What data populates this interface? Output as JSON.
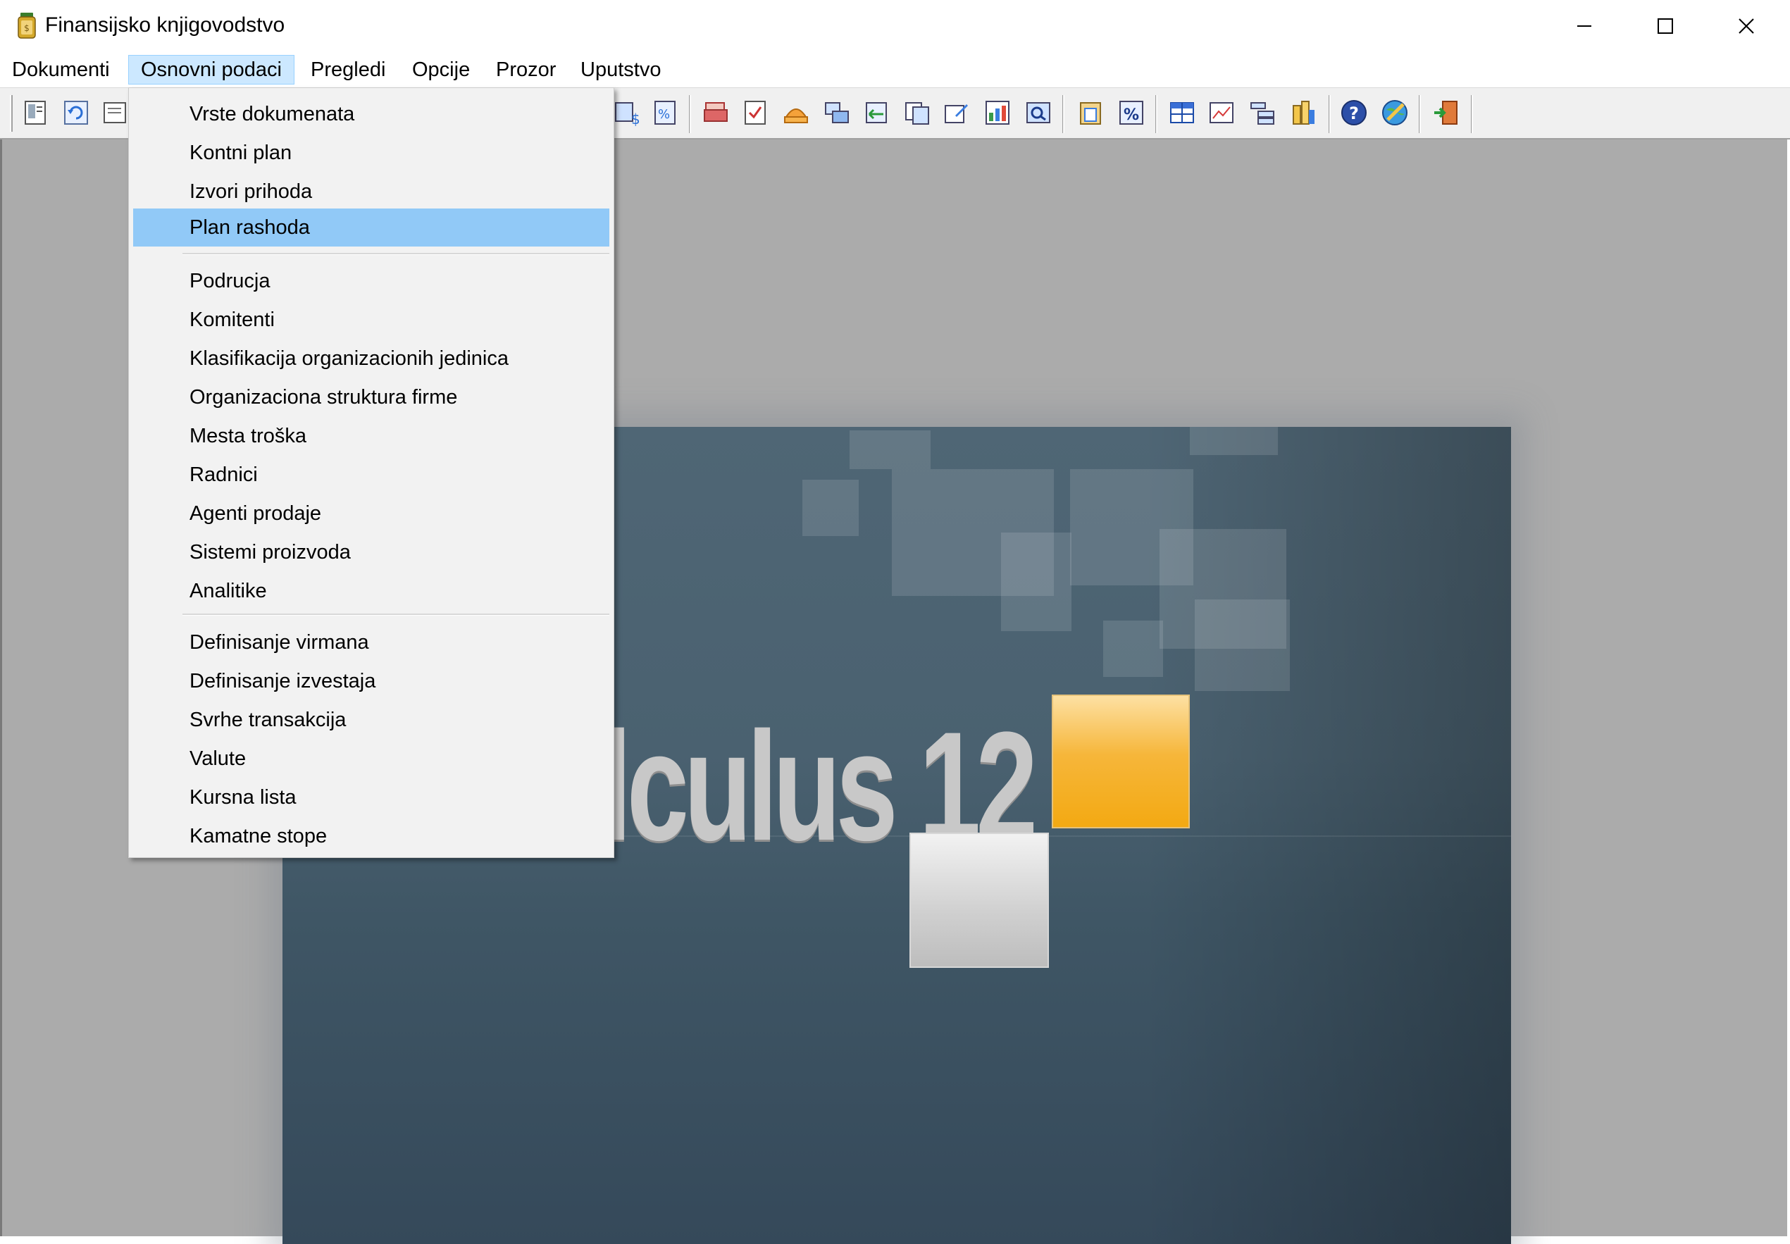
{
  "window": {
    "title": "Finansijsko knjigovodstvo",
    "icon": "app-jar-icon",
    "controls": [
      "minimize-icon",
      "maximize-icon",
      "close-icon"
    ]
  },
  "menubar": {
    "items": [
      "Dokumenti",
      "Osnovni podaci",
      "Pregledi",
      "Opcije",
      "Prozor",
      "Uputstvo"
    ],
    "open_item": "Osnovni podaci"
  },
  "dropdown": {
    "highlighted": "Plan rashoda",
    "groups": [
      [
        "Vrste dokumenata",
        "Kontni plan",
        "Izvori prihoda",
        "Plan rashoda"
      ],
      [
        "Podrucja",
        "Komitenti",
        "Klasifikacija organizacionih jedinica",
        "Organizaciona struktura firme",
        "Mesta troška",
        "Radnici",
        "Agenti prodaje",
        "Sistemi proizvoda",
        "Analitike"
      ],
      [
        "Definisanje virmana",
        "Definisanje izvestaja",
        "Svrhe transakcija",
        "Valute",
        "Kursna lista",
        "Kamatne stope"
      ]
    ]
  },
  "splash": {
    "text": "lculus 12",
    "accent_color": "#f5ad1f",
    "background_color": "#4a6170"
  },
  "toolbar": {
    "icons": [
      "document-icon",
      "refresh-icon",
      "list-icon",
      "finance-icon",
      "calculator-icon",
      "printer-icon",
      "checklist-icon",
      "stack-icon",
      "windows-icon",
      "transfer-icon",
      "copy-icon",
      "edit-icon",
      "table-icon",
      "search-icon",
      "clipboard-icon",
      "percent-icon",
      "grid-icon",
      "chart-icon",
      "tree-icon",
      "coins-icon",
      "help-icon",
      "globe-icon",
      "exit-icon"
    ]
  }
}
